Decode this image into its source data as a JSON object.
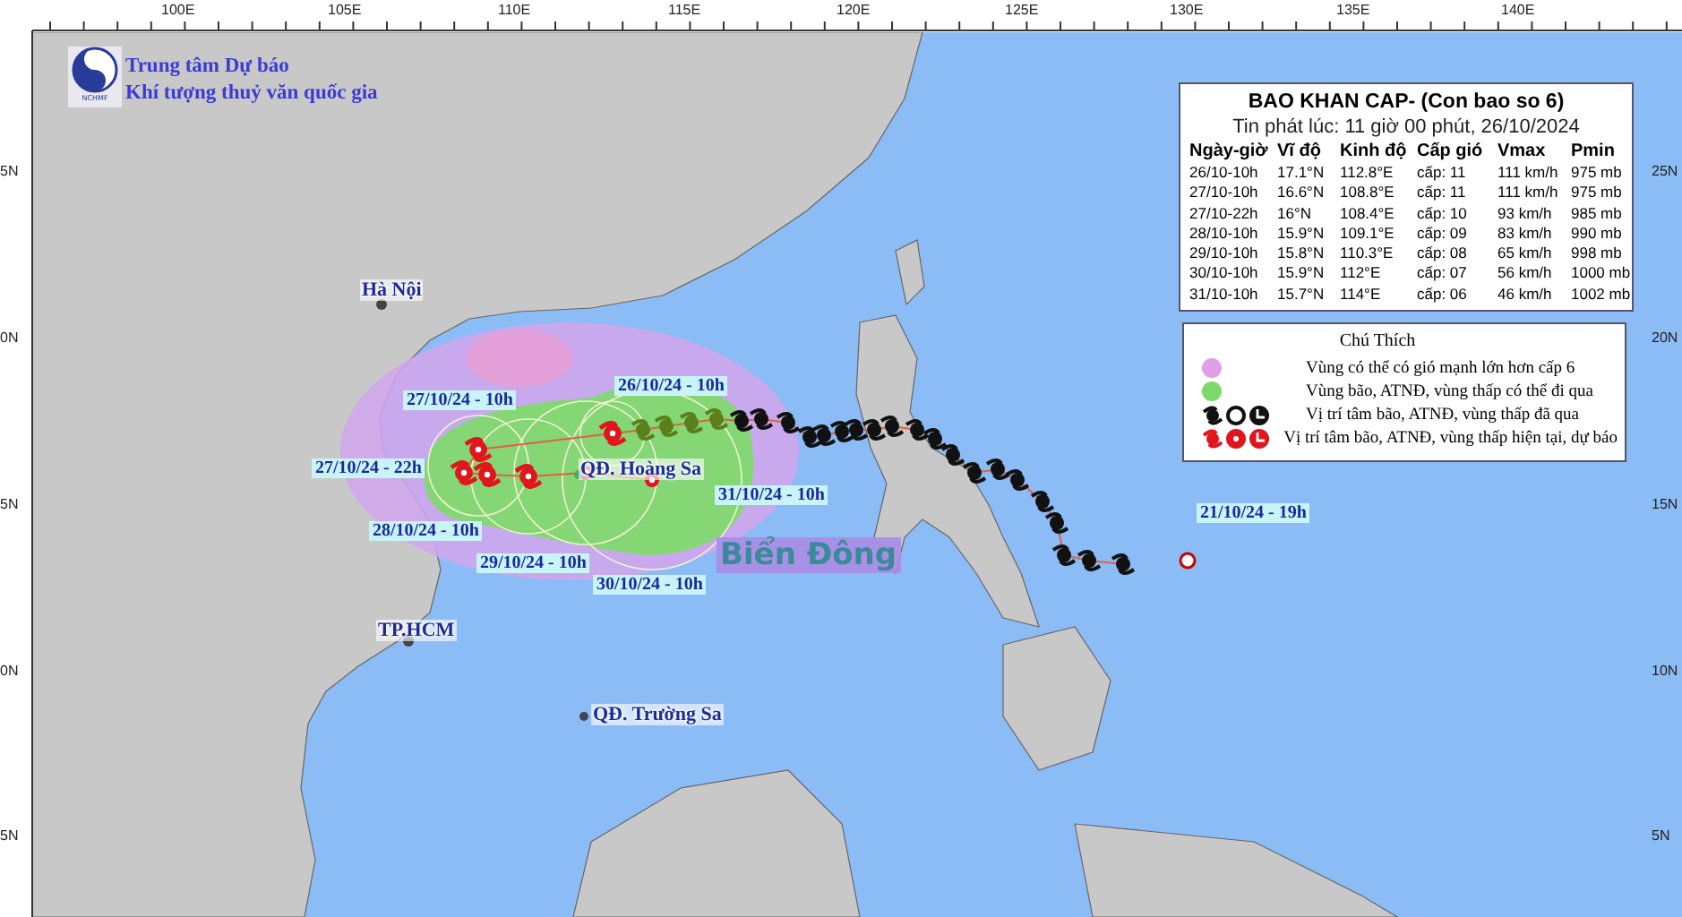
{
  "header": {
    "logo_text": "NCHMF",
    "lines": [
      "Trung tâm Dự báo",
      "Khí tượng thuỷ văn quốc gia"
    ]
  },
  "axes": {
    "longitudes": [
      "100E",
      "105E",
      "110E",
      "115E",
      "120E",
      "125E",
      "130E",
      "135E",
      "140E"
    ],
    "latitudes_left": [
      "5N",
      "0N",
      "5N",
      "0N",
      "5N"
    ],
    "latitudes_right": [
      "25N",
      "20N",
      "15N",
      "10N",
      "5N"
    ]
  },
  "map_labels": [
    {
      "kind": "place",
      "text": "Hà Nội"
    },
    {
      "kind": "place",
      "text": "QĐ. Hoàng Sa"
    },
    {
      "kind": "place",
      "text": "TP.HCM"
    },
    {
      "kind": "place",
      "text": "QĐ. Trường Sa"
    },
    {
      "kind": "sea",
      "text": "Biển Đông"
    }
  ],
  "track_labels": [
    "26/10/24 - 10h",
    "27/10/24 - 10h",
    "27/10/24 - 22h",
    "28/10/24 - 10h",
    "29/10/24 - 10h",
    "30/10/24 - 10h",
    "31/10/24 - 10h",
    "21/10/24 - 19h"
  ],
  "bulletin": {
    "title": "BAO KHAN CAP- (Con bao so 6)",
    "subtitle": "Tin phát lúc: 11 giờ 00 phút, 26/10/2024",
    "columns": [
      "Ngày-giờ",
      "Vĩ độ",
      "Kinh độ",
      "Cấp gió",
      "Vmax",
      "Pmin"
    ],
    "rows": [
      [
        "26/10-10h",
        "17.1°N",
        "112.8°E",
        "cấp: 11",
        "111 km/h",
        "975 mb"
      ],
      [
        "27/10-10h",
        "16.6°N",
        "108.8°E",
        "cấp: 11",
        "111 km/h",
        "975 mb"
      ],
      [
        "27/10-22h",
        "16°N",
        "108.4°E",
        "cấp: 10",
        "93 km/h",
        "985 mb"
      ],
      [
        "28/10-10h",
        "15.9°N",
        "109.1°E",
        "cấp: 09",
        "83 km/h",
        "990 mb"
      ],
      [
        "29/10-10h",
        "15.8°N",
        "110.3°E",
        "cấp: 08",
        "65 km/h",
        "998 mb"
      ],
      [
        "30/10-10h",
        "15.9°N",
        "112°E",
        "cấp: 07",
        "56 km/h",
        "1000 mb"
      ],
      [
        "31/10-10h",
        "15.7°N",
        "114°E",
        "cấp: 06",
        "46 km/h",
        "1002 mb"
      ]
    ]
  },
  "legend": {
    "title": "Chú Thích",
    "items": [
      {
        "kind": "wind-zone",
        "text": "Vùng có thể có gió mạnh lớn hơn cấp 6"
      },
      {
        "kind": "storm-zone",
        "text": "Vùng bão, ATNĐ, vùng thấp có thể đi qua"
      },
      {
        "kind": "past",
        "text": "Vị trí tâm bão, ATNĐ, vùng thấp đã qua"
      },
      {
        "kind": "forecast",
        "text": "Vị trí tâm bão, ATNĐ, vùng thấp hiện tại, dự báo"
      }
    ]
  }
}
